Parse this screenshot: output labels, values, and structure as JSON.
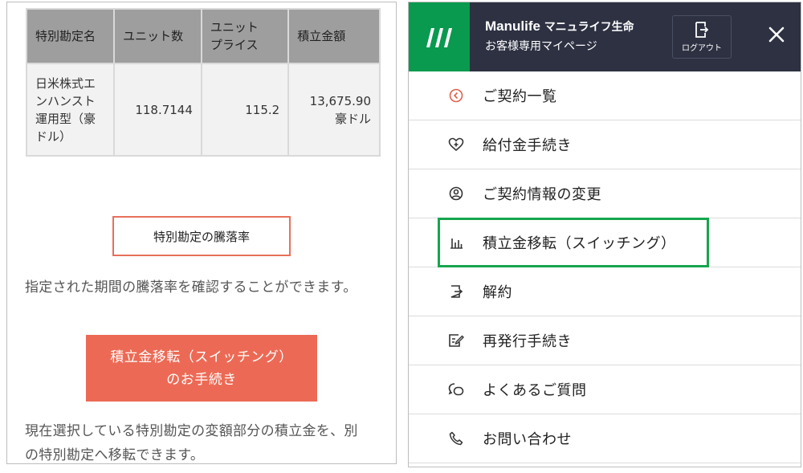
{
  "fund_table": {
    "headers": [
      "特別勘定名",
      "ユニット数",
      "ユニット\nプライス",
      "積立金額"
    ],
    "row": {
      "name": "日米株式エ\nンハンスト\n運用型（豪\nドル）",
      "units": "118.7144",
      "unit_price": "115.2",
      "amount": "13,675.90\n豪ドル"
    }
  },
  "rate_button": {
    "label": "特別勘定の騰落率"
  },
  "rate_description": "指定された期間の騰落率を確認することができます。",
  "switch_button": {
    "line1": "積立金移転（スイッチング）",
    "line2": "のお手続き"
  },
  "switch_description": "現在選択している特別勘定の変額部分の積立金を、別\nの特別勘定へ移転できます。",
  "header": {
    "brand_latin": "Manulife",
    "brand_jp": "マニュライフ生命",
    "subtitle": "お客様専用マイページ",
    "logout_label": "ログアウト",
    "logo_icon": "manulife-logo-icon",
    "close_icon": "close-icon"
  },
  "colors": {
    "brand_green": "#0a9a4f",
    "header_navy": "#2d3142",
    "accent_red": "#ec6a55",
    "highlight_green": "#17a54f"
  },
  "menu": [
    {
      "label": "ご契約一覧",
      "icon": "chevron-left-circle-icon"
    },
    {
      "label": "給付金手続き",
      "icon": "heart-plus-icon"
    },
    {
      "label": "ご契約情報の変更",
      "icon": "user-circle-icon"
    },
    {
      "label": "積立金移転（スイッチング）",
      "icon": "bar-chart-icon",
      "highlighted": true
    },
    {
      "label": "解約",
      "icon": "exit-door-icon"
    },
    {
      "label": "再発行手続き",
      "icon": "document-edit-icon"
    },
    {
      "label": "よくあるご質問",
      "icon": "chat-question-icon"
    },
    {
      "label": "お問い合わせ",
      "icon": "phone-icon"
    }
  ]
}
